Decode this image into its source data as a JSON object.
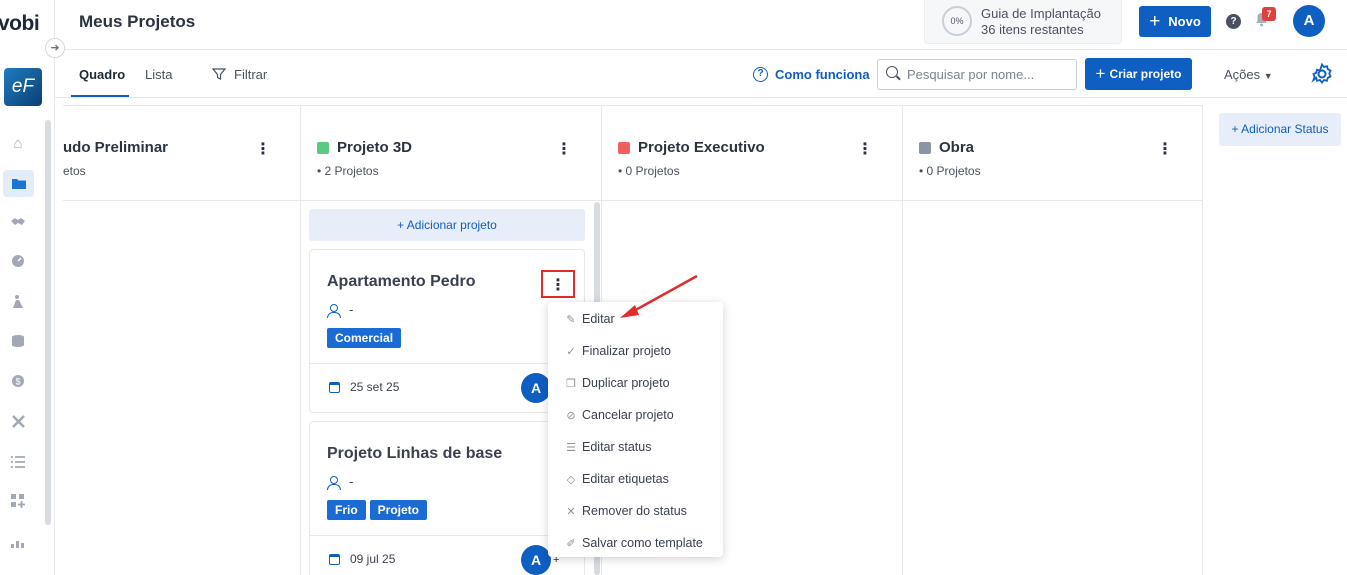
{
  "app": {
    "logo": "vobi",
    "company_initials": "eF"
  },
  "header": {
    "title": "Meus Projetos",
    "guide": {
      "progress": "0%",
      "title": "Guia de Implantação",
      "subtitle": "36 itens restantes"
    },
    "new_button": "Novo",
    "notifications_count": "7",
    "user_initial": "A"
  },
  "toolbar": {
    "tabs": [
      {
        "label": "Quadro",
        "active": true
      },
      {
        "label": "Lista",
        "active": false
      }
    ],
    "filter_label": "Filtrar",
    "how_works_label": "Como funciona",
    "search_placeholder": "Pesquisar por nome...",
    "create_button": "Criar projeto",
    "actions_label": "Ações"
  },
  "sidebar": {
    "items": [
      {
        "icon": "home-icon",
        "active": false
      },
      {
        "icon": "folder-icon",
        "active": true
      },
      {
        "icon": "handshake-icon",
        "active": false
      },
      {
        "icon": "speedometer-icon",
        "active": false
      },
      {
        "icon": "worker-icon",
        "active": false
      },
      {
        "icon": "database-icon",
        "active": false
      },
      {
        "icon": "dollar-icon",
        "active": false
      },
      {
        "icon": "tools-icon",
        "active": false
      },
      {
        "icon": "list-icon",
        "active": false
      },
      {
        "icon": "apps-add-icon",
        "active": false
      },
      {
        "icon": "chart-icon",
        "active": false
      }
    ]
  },
  "board": {
    "columns": [
      {
        "title": "udo Preliminar",
        "count": "etos",
        "color": null
      },
      {
        "title": "Projeto 3D",
        "count": "2 Projetos",
        "color": "#58c97e"
      },
      {
        "title": "Projeto Executivo",
        "count": "0 Projetos",
        "color": "#f0605d"
      },
      {
        "title": "Obra",
        "count": "0 Projetos",
        "color": "#8a94a6"
      }
    ],
    "add_status_label": "+ Adicionar Status",
    "add_project_label": "+ Adicionar projeto",
    "cards": [
      {
        "title": "Apartamento Pedro",
        "person": "-",
        "tags": [
          "Comercial"
        ],
        "date": "25 set 25",
        "avatar": "A"
      },
      {
        "title": "Projeto Linhas de base",
        "person": "-",
        "tags": [
          "Frio",
          "Projeto"
        ],
        "date": "09 jul 25",
        "avatar": "A",
        "avatar_extra": "+"
      }
    ]
  },
  "context_menu": {
    "items": [
      {
        "label": "Editar",
        "icon": "edit-icon"
      },
      {
        "label": "Finalizar projeto",
        "icon": "check-icon"
      },
      {
        "label": "Duplicar projeto",
        "icon": "copy-icon"
      },
      {
        "label": "Cancelar projeto",
        "icon": "cancel-icon"
      },
      {
        "label": "Editar status",
        "icon": "status-icon"
      },
      {
        "label": "Editar etiquetas",
        "icon": "tag-icon"
      },
      {
        "label": "Remover do status",
        "icon": "close-icon"
      },
      {
        "label": "Salvar como template",
        "icon": "pencil-icon"
      }
    ]
  },
  "colors": {
    "primary": "#0f5ec2",
    "highlight": "#e22c2c",
    "tag": "#1b6bd4"
  }
}
